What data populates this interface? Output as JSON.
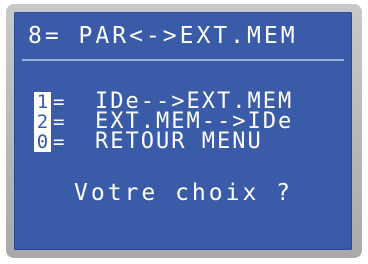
{
  "header": {
    "title": "8= PAR<->EXT.MEM"
  },
  "menu": {
    "items": [
      {
        "key": "1",
        "sep": "=",
        "label": "IDe-->EXT.MEM"
      },
      {
        "key": "2",
        "sep": "=",
        "label": "EXT.MEM-->IDe"
      },
      {
        "key": "0",
        "sep": "=",
        "label": "RETOUR MENU"
      }
    ]
  },
  "prompt": {
    "text": "Votre choix ?"
  },
  "colors": {
    "screen": "#3a5ba8",
    "text": "#ffffff",
    "bezel": "#b8b8b8"
  }
}
